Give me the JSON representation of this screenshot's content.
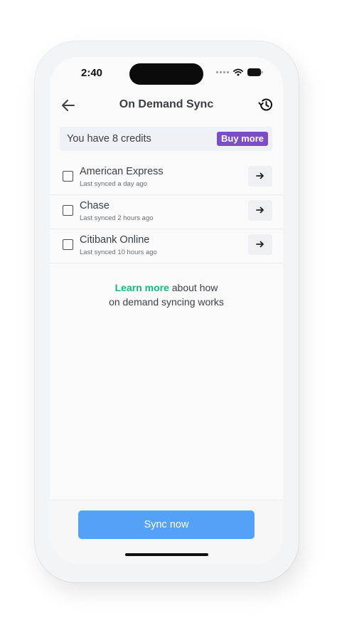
{
  "status_bar": {
    "time": "2:40",
    "icons": [
      "signal-dots-icon",
      "wifi-icon",
      "battery-icon"
    ]
  },
  "nav": {
    "title": "On Demand Sync",
    "back_icon": "arrow-left-icon",
    "history_icon": "history-icon"
  },
  "credits": {
    "text": "You have 8 credits",
    "buy_label": "Buy more"
  },
  "accounts": [
    {
      "name": "American Express",
      "last_synced": "Last synced a day ago",
      "checked": false
    },
    {
      "name": "Chase",
      "last_synced": "Last synced 2 hours ago",
      "checked": false
    },
    {
      "name": "Citibank Online",
      "last_synced": "Last synced 10 hours ago",
      "checked": false
    }
  ],
  "info": {
    "link_text": "Learn more",
    "text_after_link": " about how",
    "line2": "on demand syncing works"
  },
  "footer": {
    "sync_label": "Sync now"
  },
  "colors": {
    "accent_green": "#1fb47d",
    "buy_purple": "#7c4dc4",
    "sync_blue": "#53a2f8",
    "banner_bg": "#eef1f5"
  }
}
